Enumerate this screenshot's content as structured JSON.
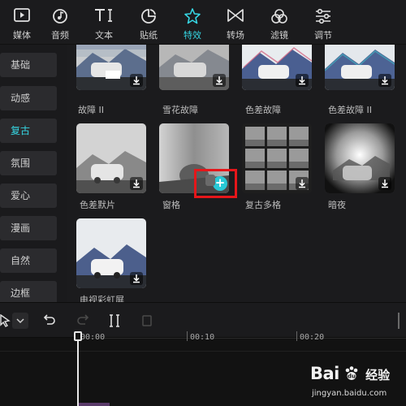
{
  "toolbar": {
    "items": [
      {
        "label": "媒体",
        "icon": "media-icon"
      },
      {
        "label": "音频",
        "icon": "audio-icon"
      },
      {
        "label": "文本",
        "icon": "text-icon"
      },
      {
        "label": "贴纸",
        "icon": "sticker-icon"
      },
      {
        "label": "特效",
        "icon": "effects-icon",
        "active": true
      },
      {
        "label": "转场",
        "icon": "transition-icon"
      },
      {
        "label": "滤镜",
        "icon": "filter-icon"
      },
      {
        "label": "调节",
        "icon": "adjust-icon"
      }
    ],
    "accent_color": "#36d6e3"
  },
  "sidebar": {
    "items": [
      {
        "label": "基础"
      },
      {
        "label": "动感"
      },
      {
        "label": "复古",
        "active": true
      },
      {
        "label": "氛围"
      },
      {
        "label": "爱心"
      },
      {
        "label": "漫画"
      },
      {
        "label": "自然"
      },
      {
        "label": "边框"
      }
    ]
  },
  "effects": {
    "cards": [
      {
        "label": "故障 II",
        "style": "glitch"
      },
      {
        "label": "雪花故障",
        "style": "snow"
      },
      {
        "label": "色差故障",
        "style": "chroma"
      },
      {
        "label": "色差故障 II",
        "style": "chroma"
      },
      {
        "label": "色差默片",
        "style": "mono-noise"
      },
      {
        "label": "窗格",
        "style": "pane"
      },
      {
        "label": "复古多格",
        "style": "multi-grid"
      },
      {
        "label": "暗夜",
        "style": "vignette"
      },
      {
        "label": "电视彩虹屏",
        "style": "tv"
      }
    ],
    "add_button": "+",
    "highlight_color": "#e5161a"
  },
  "timeline": {
    "ticks": [
      "00:00",
      "00:10",
      "00:20"
    ]
  },
  "watermark": {
    "brand": "Bai",
    "brand_suffix": "经验",
    "url": "jingyan.baidu.com"
  }
}
